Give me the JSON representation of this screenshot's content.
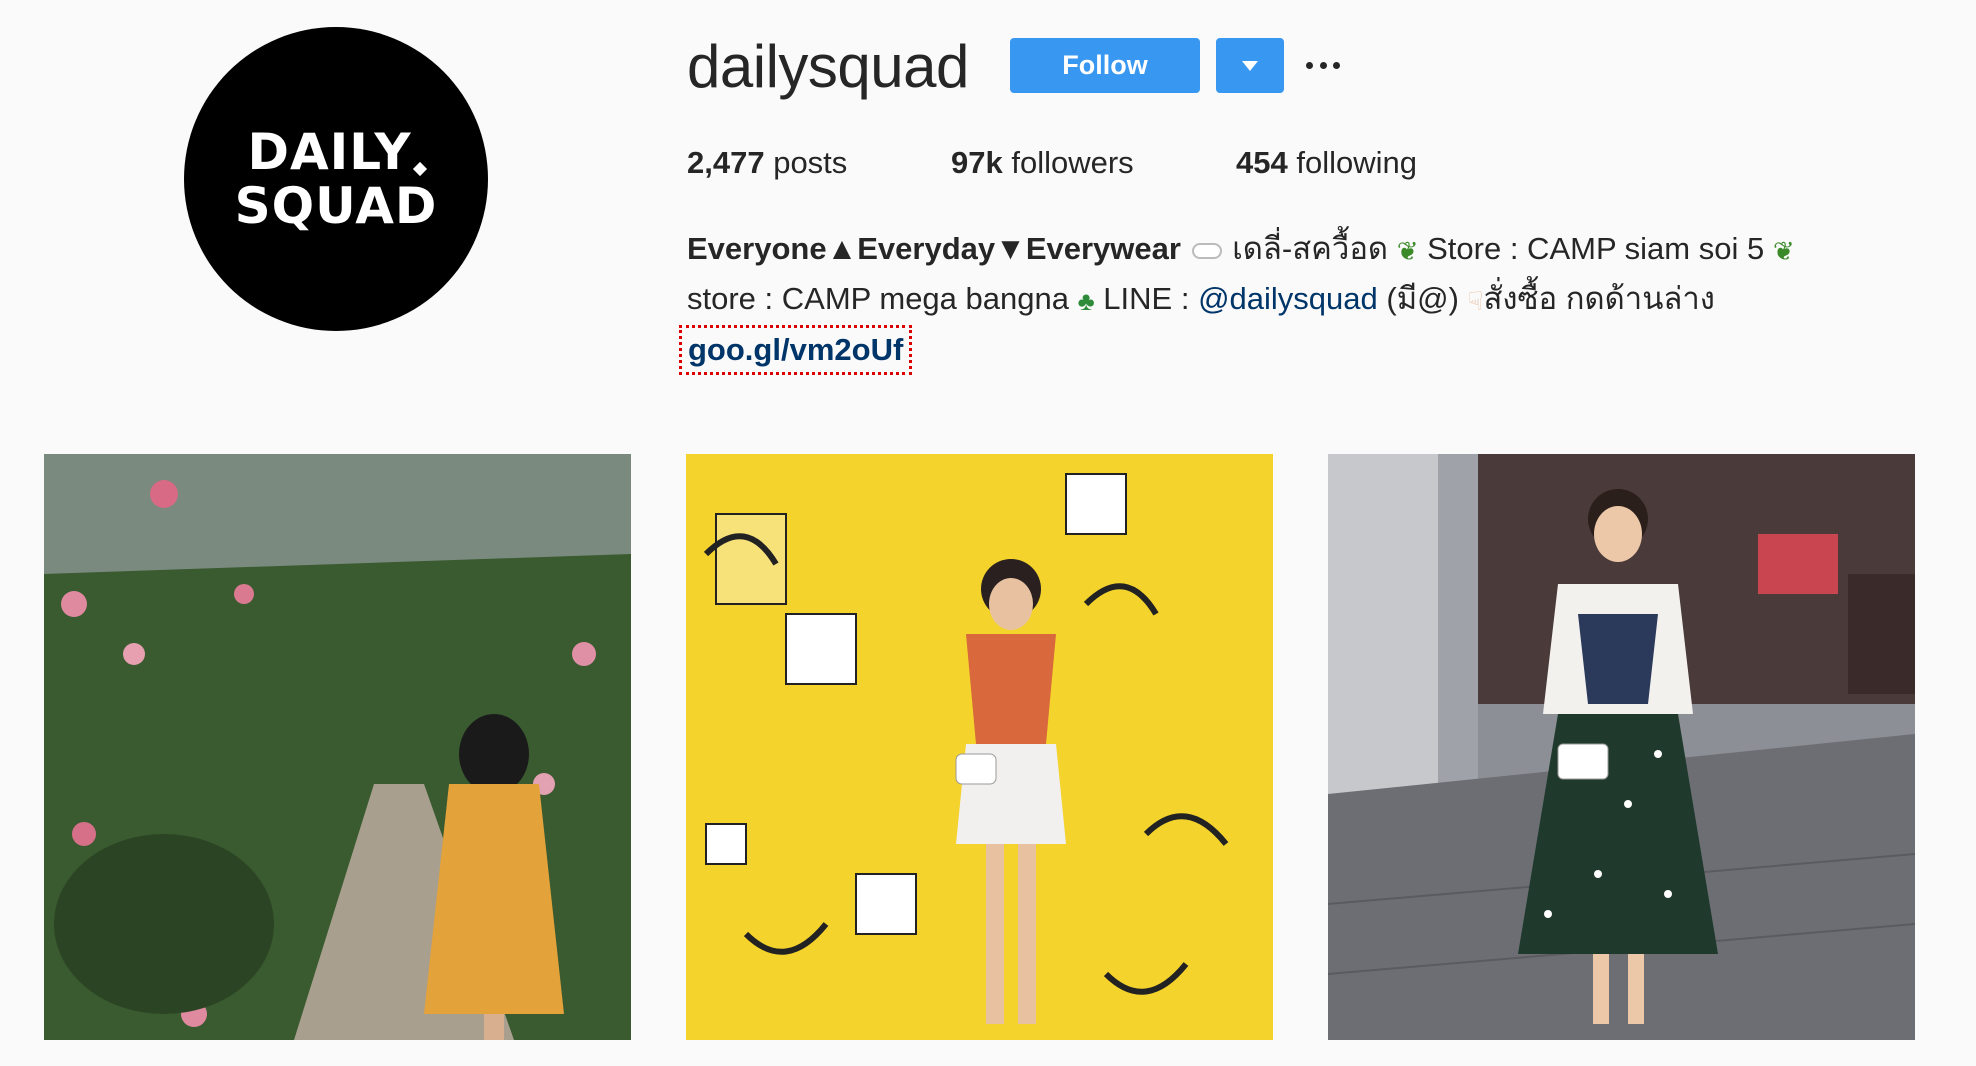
{
  "profile": {
    "avatar_lines": [
      "DAILY",
      "SQUAD"
    ],
    "username": "dailysquad",
    "follow_label": "Follow",
    "stats": [
      {
        "value": "2,477",
        "label": "posts"
      },
      {
        "value": "97k",
        "label": "followers"
      },
      {
        "value": "454",
        "label": "following"
      }
    ],
    "bio": {
      "name": "Everyone▲Everyday▼Everywear",
      "line1_rest": "เดลี่-สควื้อด",
      "line1_store": "Store : CAMP siam soi 5",
      "line2_store": "store : CAMP mega bangna",
      "line2_line": "LINE :",
      "mention": "@dailysquad",
      "line2_after_mention": "(มี@)",
      "line2_order": "สั่งซื้อ กดด้านล่าง",
      "link": "goo.gl/vm2oUf"
    }
  },
  "posts": [
    {
      "id": "post-1",
      "alt": "Woman in yellow floral dress taking photo in rose garden"
    },
    {
      "id": "post-2",
      "alt": "Woman in orange top posing in front of yellow poster wall"
    },
    {
      "id": "post-3",
      "alt": "Woman in white tee and polka dot skirt holding drink"
    }
  ],
  "colors": {
    "accent": "#3897f0",
    "link": "#003569",
    "background": "#fafafa"
  }
}
